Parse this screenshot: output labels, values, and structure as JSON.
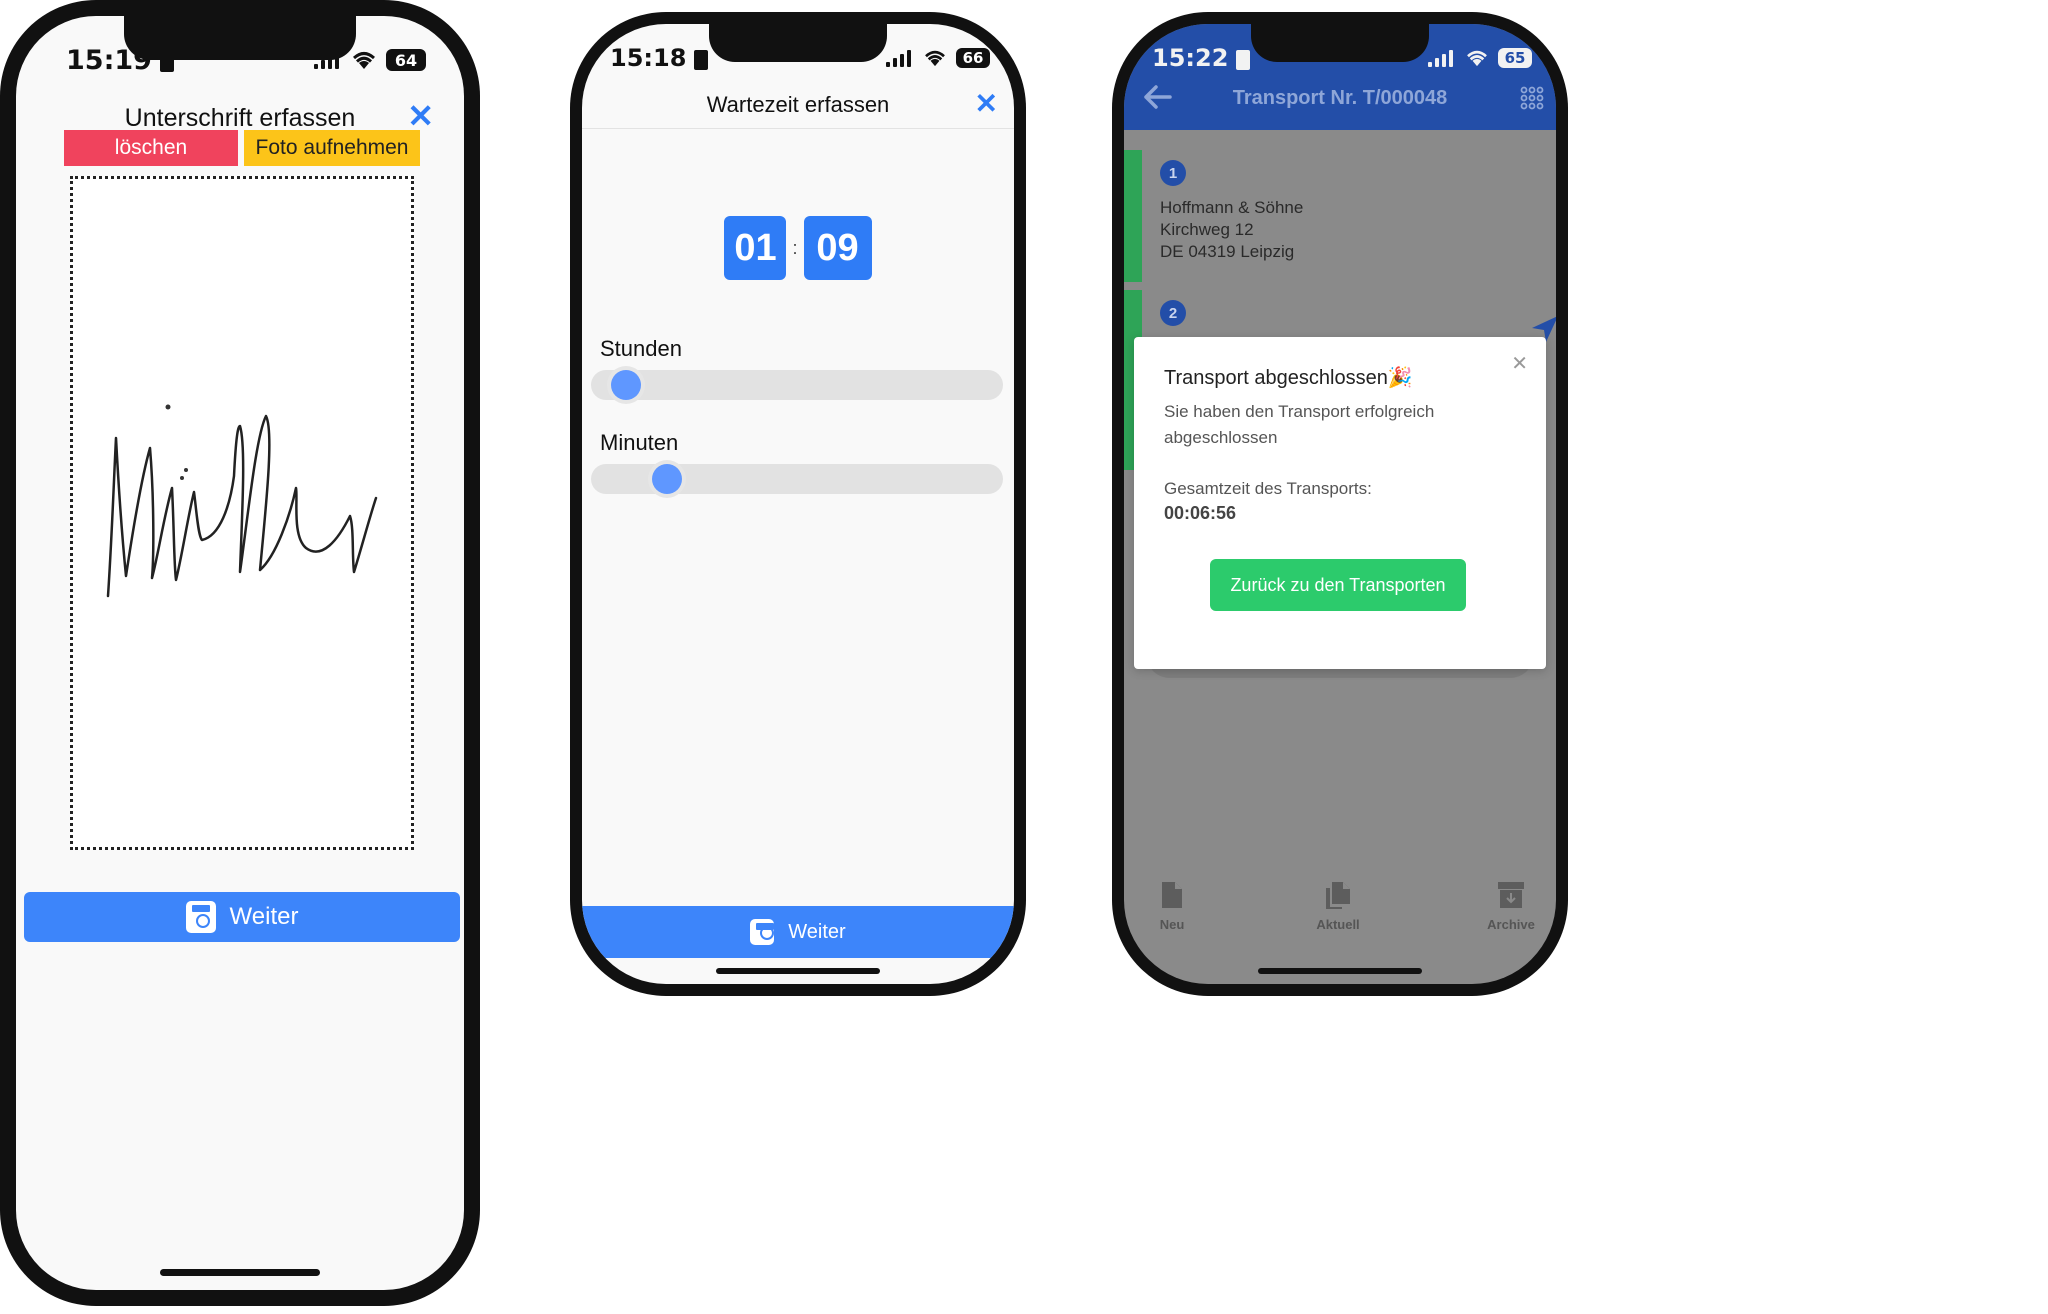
{
  "colors": {
    "primary": "#3d85fa",
    "danger": "#f0435d",
    "warning": "#fcc419",
    "header_blue": "#234ea8",
    "success": "#2ccb6c",
    "timer_blue": "#2f7cf6"
  },
  "icons": {
    "close": "close-icon",
    "save": "save-icon",
    "back": "arrow-left-icon",
    "menu": "grid-menu-icon",
    "navigate": "navigation-arrow-icon",
    "tab_new": "file-icon",
    "tab_current": "files-icon",
    "tab_archive": "archive-icon"
  },
  "signature_screen": {
    "status": {
      "time": "15:19",
      "battery": "64"
    },
    "title": "Unterschrift erfassen",
    "clear_label": "löschen",
    "photo_label": "Foto aufnehmen",
    "signature_text": "Müller",
    "submit_label": "Weiter"
  },
  "wait_screen": {
    "status": {
      "time": "15:18",
      "battery": "66"
    },
    "title": "Wartezeit erfassen",
    "timer": {
      "hours": "01",
      "separator": ":",
      "minutes": "09"
    },
    "hours_label": "Stunden",
    "hours_value": 1,
    "hours_max": 24,
    "minutes_label": "Minuten",
    "minutes_value": 9,
    "minutes_max": 59,
    "submit_label": "Weiter"
  },
  "transport_screen": {
    "status": {
      "time": "15:22",
      "battery": "65"
    },
    "header_title": "Transport Nr. T/000048",
    "stops": [
      {
        "number": "1",
        "name": "Hoffmann & Söhne",
        "street": "Kirchweg 12",
        "city": "DE 04319 Leipzig"
      },
      {
        "number": "2"
      }
    ],
    "modal": {
      "title": "Transport abgeschlossen",
      "emoji": "🎉",
      "message": "Sie haben den Transport erfolgreich abgeschlossen",
      "duration_label": "Gesamtzeit des Transports:",
      "duration_value": "00:06:56",
      "button_label": "Zurück zu den Transporten"
    },
    "tabs": [
      {
        "label": "Neu"
      },
      {
        "label": "Aktuell"
      },
      {
        "label": "Archive"
      }
    ]
  }
}
